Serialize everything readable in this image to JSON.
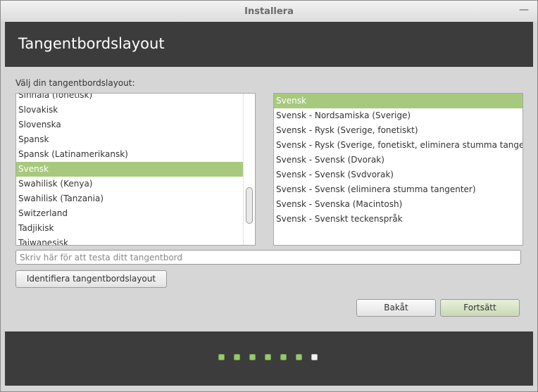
{
  "window": {
    "title": "Installera"
  },
  "header": {
    "title": "Tangentbordslayout"
  },
  "prompt": "Välj din tangentbordslayout:",
  "layouts": [
    "Sinhala (fonetisk)",
    "Slovakisk",
    "Slovenska",
    "Spansk",
    "Spansk (Latinamerikansk)",
    "Svensk",
    "Swahilisk (Kenya)",
    "Swahilisk (Tanzania)",
    "Switzerland",
    "Tadjikisk",
    "Taiwanesisk"
  ],
  "selected_layout_index": 5,
  "variants": [
    "Svensk",
    "Svensk - Nordsamiska (Sverige)",
    "Svensk - Rysk (Sverige, fonetiskt)",
    "Svensk - Rysk (Sverige, fonetiskt, eliminera stumma tangenter)",
    "Svensk - Svensk (Dvorak)",
    "Svensk - Svensk (Svdvorak)",
    "Svensk - Svensk (eliminera stumma tangenter)",
    "Svensk - Svenska (Macintosh)",
    "Svensk - Svenskt teckenspråk"
  ],
  "selected_variant_index": 0,
  "test_input": {
    "placeholder": "Skriv här för att testa ditt tangentbord",
    "value": ""
  },
  "buttons": {
    "identify": "Identifiera tangentbordslayout",
    "back": "Bakåt",
    "forward": "Fortsätt"
  },
  "progress": {
    "total_steps": 7,
    "current_step": 7
  },
  "colors": {
    "selection": "#a7c97d",
    "header_bg": "#3c3c3c",
    "step_done": "#9ac86f"
  }
}
